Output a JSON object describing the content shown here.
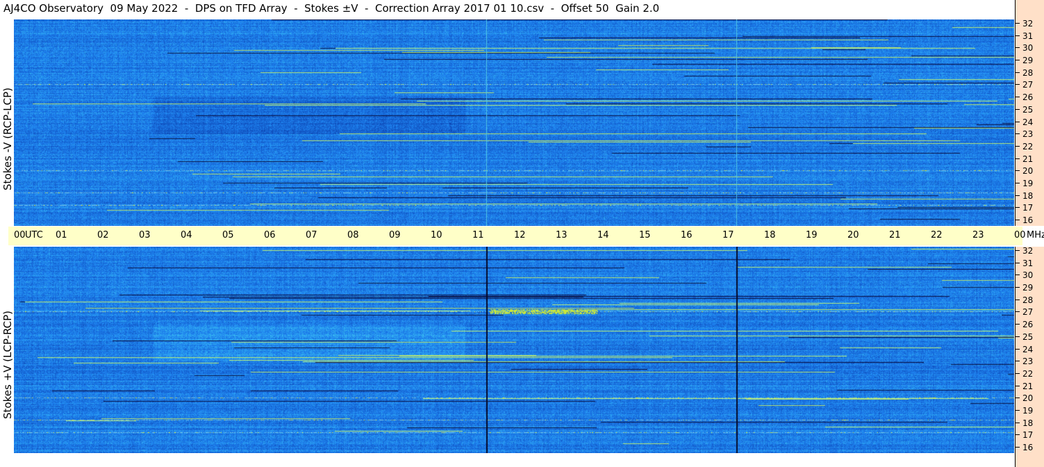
{
  "title": "AJ4CO Observatory  09 May 2022  -  DPS on TFD Array  -  Stokes ±V  -  Correction Array 2017 01 10.csv  -  Offset 50  Gain 2.0",
  "panels": {
    "top": {
      "ylabel": "Stokes -V (RCP-LCP)"
    },
    "bottom": {
      "ylabel": "Stokes +V (LCP-RCP)"
    }
  },
  "time_axis": {
    "labels": [
      "00",
      "UTC",
      "01",
      "02",
      "03",
      "04",
      "05",
      "06",
      "07",
      "08",
      "09",
      "10",
      "11",
      "12",
      "13",
      "14",
      "15",
      "16",
      "17",
      "18",
      "19",
      "20",
      "21",
      "22",
      "23",
      "00",
      "MHz"
    ]
  },
  "freq_axis": {
    "labels": [
      "32",
      "31",
      "30",
      "29",
      "28",
      "27",
      "26",
      "25",
      "24",
      "23",
      "22",
      "21",
      "20",
      "19",
      "18",
      "17",
      "16"
    ]
  },
  "colors": {
    "background_blue": "#2a6ee0",
    "time_bar": "#ffffc8",
    "freq_column": "#ffe0c8"
  },
  "chart_data": {
    "type": "heatmap",
    "title": "AJ4CO Observatory  09 May 2022  -  DPS on TFD Array  -  Stokes ±V  -  Correction Array 2017 01 10.csv  -  Offset 50  Gain 2.0",
    "xlabel": "UTC",
    "ylabel_top": "Stokes -V (RCP-LCP)",
    "ylabel_bottom": "Stokes +V (LCP-RCP)",
    "x_range_utc_hours": [
      0,
      24
    ],
    "y_range_mhz": [
      16,
      32
    ],
    "x_ticks": [
      "00",
      "01",
      "02",
      "03",
      "04",
      "05",
      "06",
      "07",
      "08",
      "09",
      "10",
      "11",
      "12",
      "13",
      "14",
      "15",
      "16",
      "17",
      "18",
      "19",
      "20",
      "21",
      "22",
      "23",
      "00"
    ],
    "y_ticks": [
      32,
      31,
      30,
      29,
      28,
      27,
      26,
      25,
      24,
      23,
      22,
      21,
      20,
      19,
      18,
      17,
      16
    ],
    "y_unit": "MHz",
    "notable_features": [
      {
        "panel": "both",
        "utc_hour": 11.4,
        "description": "vertical line"
      },
      {
        "panel": "both",
        "utc_hour": 17.4,
        "description": "vertical line"
      },
      {
        "panel": "bottom",
        "utc_hour_range": [
          11.4,
          13.0
        ],
        "freq_mhz": 27,
        "description": "bright emission band"
      },
      {
        "panel": "top",
        "freq_mhz": 17.2,
        "description": "persistent interference band"
      },
      {
        "panel": "top",
        "freq_mhz": 18.2,
        "description": "persistent interference band"
      }
    ]
  }
}
